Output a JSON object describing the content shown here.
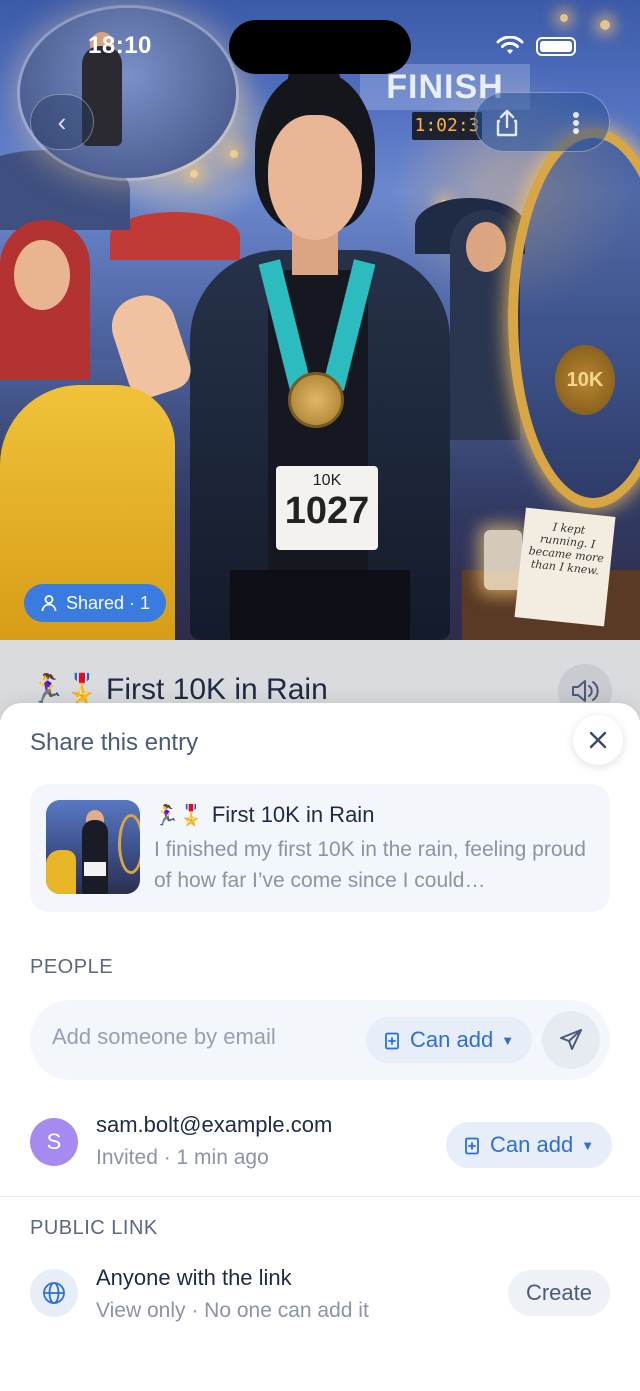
{
  "status_bar": {
    "time": "18:10"
  },
  "hero": {
    "banner_text": "FINISH",
    "clock_text": "1:02:3",
    "bib_label": "10K",
    "bib_number": "1027",
    "medal_text": "10K",
    "note_text": "I kept running. I became more than I knew."
  },
  "shared_chip": {
    "label": "Shared · 1"
  },
  "entry": {
    "emoji": "🏃‍♀️🎖️",
    "title": "First 10K in Rain"
  },
  "sheet": {
    "title": "Share this entry",
    "preview": {
      "emoji": "🏃‍♀️🎖️",
      "title": "First 10K in Rain",
      "description": "I finished my first 10K in the rain, feeling proud of how far I’ve come since I could…"
    },
    "people": {
      "section_label": "PEOPLE",
      "email_placeholder": "Add someone by email",
      "permission_label": "Can add",
      "members": [
        {
          "initial": "S",
          "email": "sam.bolt@example.com",
          "status": "Invited · 1 min ago",
          "permission": "Can add"
        }
      ]
    },
    "public_link": {
      "section_label": "PUBLIC LINK",
      "title": "Anyone with the link",
      "subtitle": "View only · No one can add it",
      "create_label": "Create"
    }
  },
  "colors": {
    "accent": "#2d6fd6",
    "chip": "#3a7be0",
    "avatar": "#a78af0"
  },
  "icons": [
    "back-icon",
    "share-icon",
    "more-icon",
    "user-icon",
    "speaker-icon",
    "close-icon",
    "book-icon",
    "send-icon",
    "globe-icon"
  ]
}
